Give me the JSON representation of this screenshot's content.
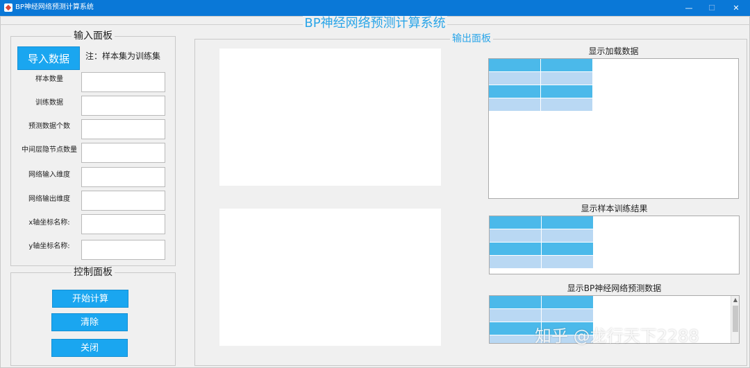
{
  "window": {
    "title": "BP神经网络预测计算系统",
    "controls": {
      "minimize": "—",
      "maximize": "☐",
      "close": "✕"
    }
  },
  "main_title": "BP神经网络预测计算系统",
  "input_panel": {
    "legend": "输入面板",
    "import_button": "导入数据",
    "note": "注：样本集为训练集",
    "fields": [
      {
        "label": "样本数量",
        "value": ""
      },
      {
        "label": "训练数据",
        "value": ""
      },
      {
        "label": "预测数据个数",
        "value": ""
      },
      {
        "label": "中间层隐节点数量",
        "value": ""
      },
      {
        "label": "网络输入维度",
        "value": ""
      },
      {
        "label": "网络输出维度",
        "value": ""
      },
      {
        "label": "x轴坐标名称:",
        "value": ""
      },
      {
        "label": "y轴坐标名称:",
        "value": ""
      }
    ]
  },
  "control_panel": {
    "legend": "控制面板",
    "start_button": "开始计算",
    "clear_button": "清除",
    "close_button": "关闭"
  },
  "output_panel": {
    "legend": "输出面板",
    "table_load_title": "显示加载数据",
    "table_train_title": "显示样本训练结果",
    "table_predict_title": "显示BP神经网络预测数据"
  },
  "watermark": "知乎 @龙行天下2288",
  "colors": {
    "titlebar": "#0a78d7",
    "accent_button": "#1aa6f0",
    "title_text": "#2aa5e8",
    "table_dark_row": "#4bb9ea",
    "table_light_row": "#b9d8f3"
  }
}
